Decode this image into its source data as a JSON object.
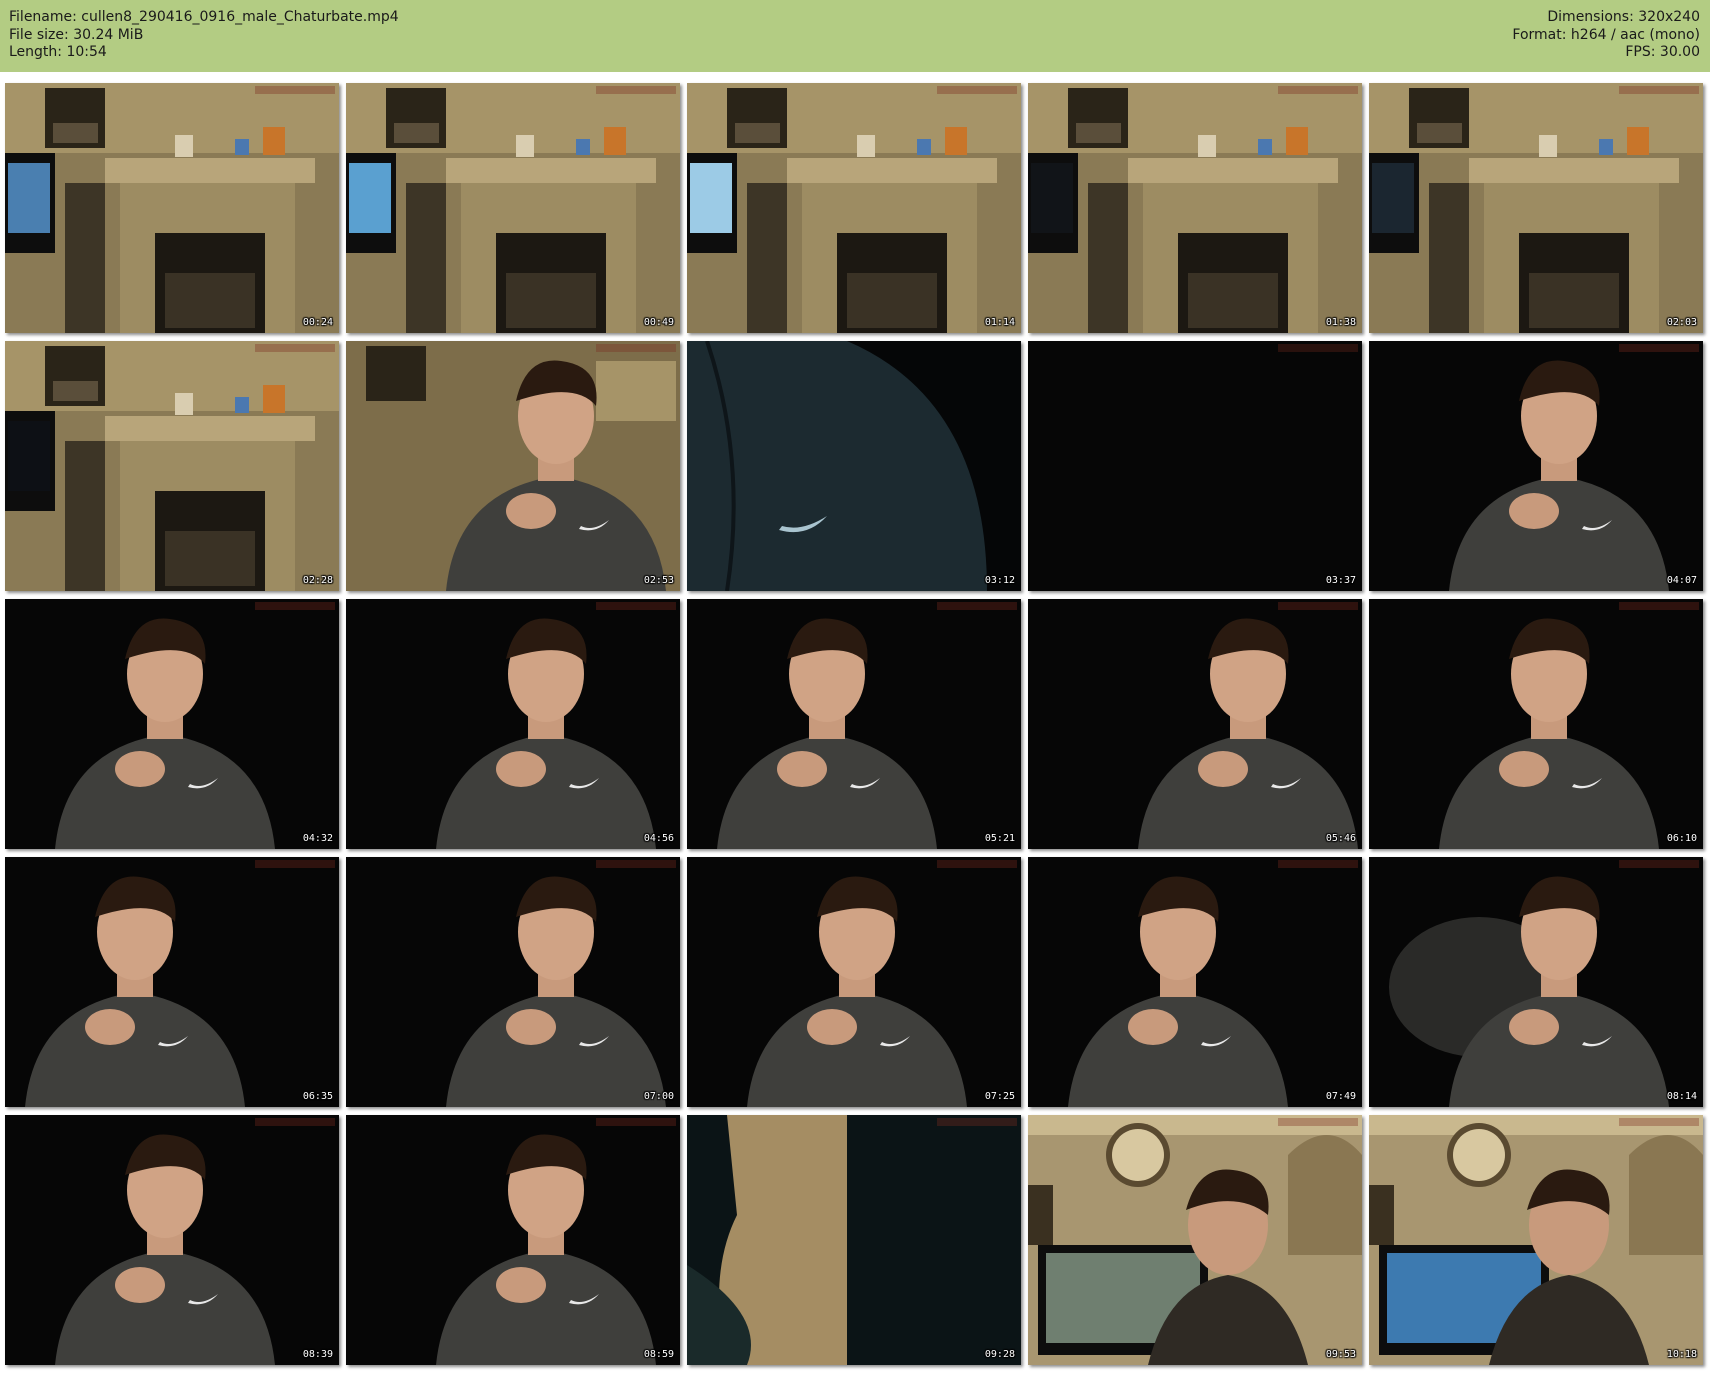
{
  "header": {
    "filename_label": "Filename: cullen8_290416_0916_male_Chaturbate.mp4",
    "filesize_label": "File size: 30.24 MiB",
    "length_label": "Length: 10:54",
    "dimensions_label": "Dimensions: 320x240",
    "format_label": "Format: h264 / aac (mono)",
    "fps_label": "FPS: 30.00",
    "background_color": "#b3cc83"
  },
  "thumbnails": [
    {
      "time": "00:24",
      "scene": "room"
    },
    {
      "time": "00:49",
      "scene": "room"
    },
    {
      "time": "01:14",
      "scene": "room"
    },
    {
      "time": "01:38",
      "scene": "room"
    },
    {
      "time": "02:03",
      "scene": "room"
    },
    {
      "time": "02:28",
      "scene": "room"
    },
    {
      "time": "02:53",
      "scene": "person-room"
    },
    {
      "time": "03:12",
      "scene": "hoodie-closeup"
    },
    {
      "time": "03:37",
      "scene": "dark"
    },
    {
      "time": "04:07",
      "scene": "person-dark"
    },
    {
      "time": "04:32",
      "scene": "person-dark"
    },
    {
      "time": "04:56",
      "scene": "person-dark"
    },
    {
      "time": "05:21",
      "scene": "person-dark"
    },
    {
      "time": "05:46",
      "scene": "person-dark"
    },
    {
      "time": "06:10",
      "scene": "person-dark"
    },
    {
      "time": "06:35",
      "scene": "person-dark"
    },
    {
      "time": "07:00",
      "scene": "person-dark"
    },
    {
      "time": "07:25",
      "scene": "person-dark"
    },
    {
      "time": "07:49",
      "scene": "person-dark"
    },
    {
      "time": "08:14",
      "scene": "person-smoke"
    },
    {
      "time": "08:39",
      "scene": "person-dark"
    },
    {
      "time": "08:59",
      "scene": "person-dark"
    },
    {
      "time": "09:28",
      "scene": "wall-closeup"
    },
    {
      "time": "09:53",
      "scene": "person-clock-room"
    },
    {
      "time": "10:18",
      "scene": "person-clock-room"
    }
  ]
}
